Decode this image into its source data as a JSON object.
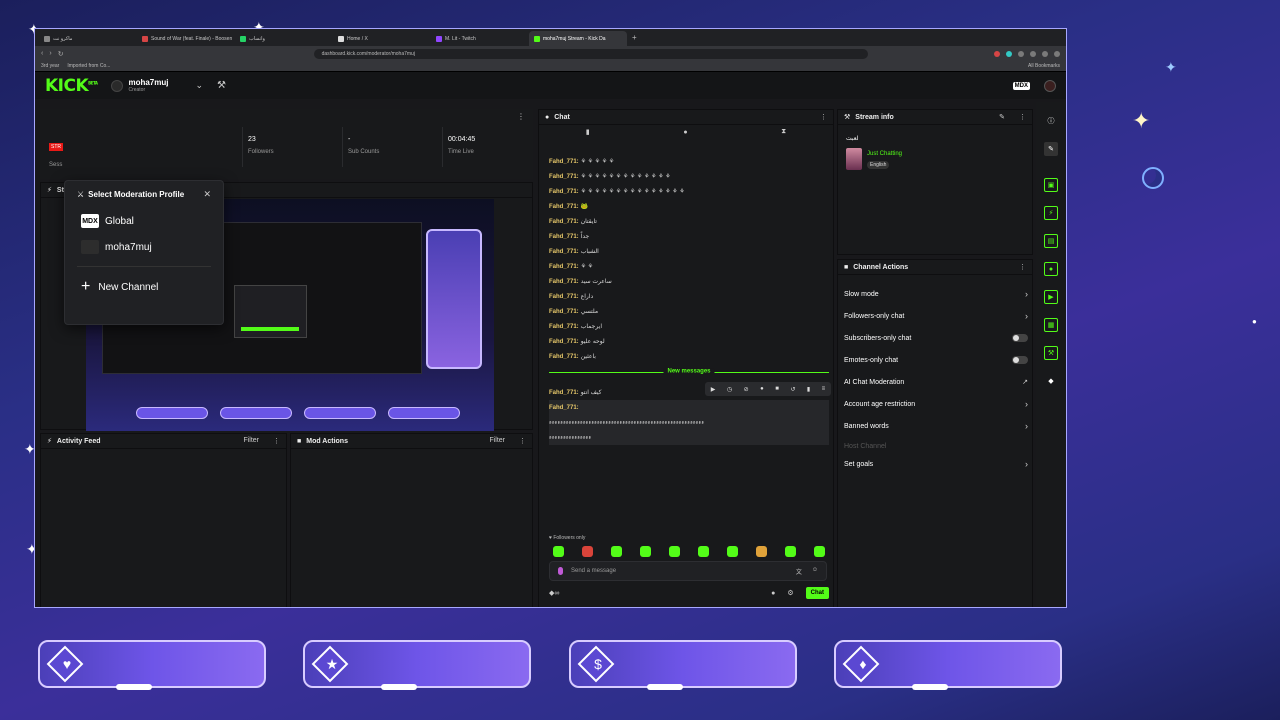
{
  "browser": {
    "tabs": [
      {
        "label": "ماكرو نت",
        "active": false
      },
      {
        "label": "Sound of War (feat. Finale) - Boosen",
        "active": false
      },
      {
        "label": "واتساب",
        "active": false
      },
      {
        "label": "Home / X",
        "active": false
      },
      {
        "label": "M. Lit - Twitch",
        "active": false
      },
      {
        "label": "moha7muj Stream - Kick Da",
        "active": true
      }
    ],
    "url": "dashboard.kick.com/moderator/moha7muj",
    "bookmarks": [
      "3rd year",
      "Imported from Co..."
    ],
    "all_bookmarks": "All Bookmarks"
  },
  "header": {
    "logo": "KICK",
    "logo_sup": "BETA",
    "channel_name": "moha7muj",
    "channel_role": "Creator",
    "badge": "MDX"
  },
  "stats": {
    "live_badge": "STR",
    "session": "Sess",
    "followers_value": "23",
    "followers_label": "Followers",
    "subs_value": "-",
    "subs_label": "Sub Counts",
    "time_value": "00:04:45",
    "time_label": "Time Live"
  },
  "mod_popup": {
    "title": "Select Moderation Profile",
    "items": [
      {
        "label": "Global",
        "icon": "MDX"
      },
      {
        "label": "moha7muj",
        "icon": ""
      }
    ],
    "new_channel": "New Channel"
  },
  "panels": {
    "stream_label": "Str",
    "activity": "Activity Feed",
    "mod_actions": "Mod Actions",
    "filter": "Filter"
  },
  "chat": {
    "title": "Chat",
    "messages": [
      {
        "user": "Fahd_771:",
        "text": "⚘ ⚘ ⚘ ⚘ ⚘"
      },
      {
        "user": "Fahd_771:",
        "text": "⚘ ⚘ ⚘ ⚘ ⚘ ⚘ ⚘ ⚘ ⚘ ⚘ ⚘ ⚘ ⚘"
      },
      {
        "user": "Fahd_771:",
        "text": "⚘ ⚘ ⚘ ⚘ ⚘ ⚘ ⚘ ⚘ ⚘ ⚘ ⚘ ⚘ ⚘ ⚘ ⚘"
      },
      {
        "user": "Fahd_771:",
        "text": "🐸"
      },
      {
        "user": "Fahd_771:",
        "text": "تايقتان"
      },
      {
        "user": "Fahd_771:",
        "text": "جداً"
      },
      {
        "user": "Fahd_771:",
        "text": "الشباب"
      },
      {
        "user": "Fahd_771:",
        "text": "⚘ ⚘"
      },
      {
        "user": "Fahd_771:",
        "text": "ساعرت سيد"
      },
      {
        "user": "Fahd_771:",
        "text": "داراع"
      },
      {
        "user": "Fahd_771:",
        "text": "ملتسي"
      },
      {
        "user": "Fahd_771:",
        "text": "ايرجماب"
      },
      {
        "user": "Fahd_771:",
        "text": "لوحه عليو"
      },
      {
        "user": "Fahd_771:",
        "text": "باعثين"
      }
    ],
    "new_messages": "New messages",
    "new_msgs": [
      {
        "user": "Fahd_771:",
        "text": "كيف انتو"
      },
      {
        "user": "Fahd_771:",
        "text": "ءءءءءءءءءءءءءءءءءءءءءءءءءءءءءءءءءءءءءءءءءءءءءءءءءءءءءءء"
      },
      {
        "user": "",
        "text": "ءءءءءءءءءءءءءءء"
      }
    ],
    "followers_only": "Followers only",
    "placeholder": "Send a message",
    "send": "Chat"
  },
  "stream_info": {
    "title": "Stream info",
    "stream_title": "لعبت",
    "category": "Just Chatting",
    "language": "English"
  },
  "channel_actions": {
    "title": "Channel Actions",
    "items": [
      {
        "label": "Slow mode",
        "control": "chevron"
      },
      {
        "label": "Followers-only chat",
        "control": "chevron"
      },
      {
        "label": "Subscribers-only chat",
        "control": "toggle"
      },
      {
        "label": "Emotes-only chat",
        "control": "toggle"
      },
      {
        "label": "AI Chat Moderation",
        "control": "external"
      },
      {
        "label": "Account age restriction",
        "control": "chevron"
      },
      {
        "label": "Banned words",
        "control": "chevron"
      },
      {
        "label": "Host Channel",
        "control": "none"
      },
      {
        "label": "Set goals",
        "control": "chevron"
      }
    ]
  },
  "colors": {
    "kick_green": "#53fc18",
    "panel_bg": "#18191b",
    "live_red": "#e91916"
  },
  "icons": {
    "cards": [
      "heart-icon",
      "star-icon",
      "dollar-icon",
      "diamond-icon"
    ]
  }
}
